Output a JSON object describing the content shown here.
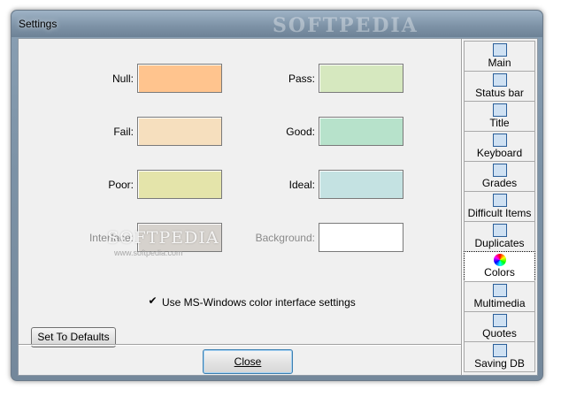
{
  "window": {
    "title": "Settings",
    "watermark": "SOFTPEDIA"
  },
  "colors_panel": {
    "rows": [
      {
        "left": {
          "label": "Null:",
          "color": "#ffc48e"
        },
        "right": {
          "label": "Pass:",
          "color": "#d6e8bf"
        }
      },
      {
        "left": {
          "label": "Fail:",
          "color": "#f6dfbe"
        },
        "right": {
          "label": "Good:",
          "color": "#b7e2cb"
        }
      },
      {
        "left": {
          "label": "Poor:",
          "color": "#e4e4aa"
        },
        "right": {
          "label": "Ideal:",
          "color": "#c4e2e2"
        }
      },
      {
        "left": {
          "label": "Interface:",
          "color": "#d6d2cd",
          "disabled": true
        },
        "right": {
          "label": "Background:",
          "color": "#ffffff",
          "disabled": true
        }
      }
    ],
    "use_windows_colors": {
      "label": "Use MS-Windows color interface settings",
      "checked": true,
      "mark": "✔"
    },
    "watermark": "SOFTPEDIA",
    "watermark_url": "www.softpedia.com"
  },
  "buttons": {
    "set_defaults": "Set To Defaults",
    "close": "Close"
  },
  "sidebar": {
    "items": [
      {
        "label": "Main",
        "icon": "main-icon",
        "active": false
      },
      {
        "label": "Status bar",
        "icon": "status-bar-icon",
        "active": false
      },
      {
        "label": "Title",
        "icon": "title-icon",
        "active": false
      },
      {
        "label": "Keyboard",
        "icon": "keyboard-icon",
        "active": false
      },
      {
        "label": "Grades",
        "icon": "grades-icon",
        "active": false
      },
      {
        "label": "Difficult Items",
        "icon": "difficult-items-icon",
        "active": false
      },
      {
        "label": "Duplicates",
        "icon": "duplicates-icon",
        "active": false
      },
      {
        "label": "Colors",
        "icon": "colors-icon",
        "active": true
      },
      {
        "label": "Multimedia",
        "icon": "multimedia-icon",
        "active": false
      },
      {
        "label": "Quotes",
        "icon": "quotes-icon",
        "active": false
      },
      {
        "label": "Saving DB",
        "icon": "saving-db-icon",
        "active": false
      }
    ]
  }
}
